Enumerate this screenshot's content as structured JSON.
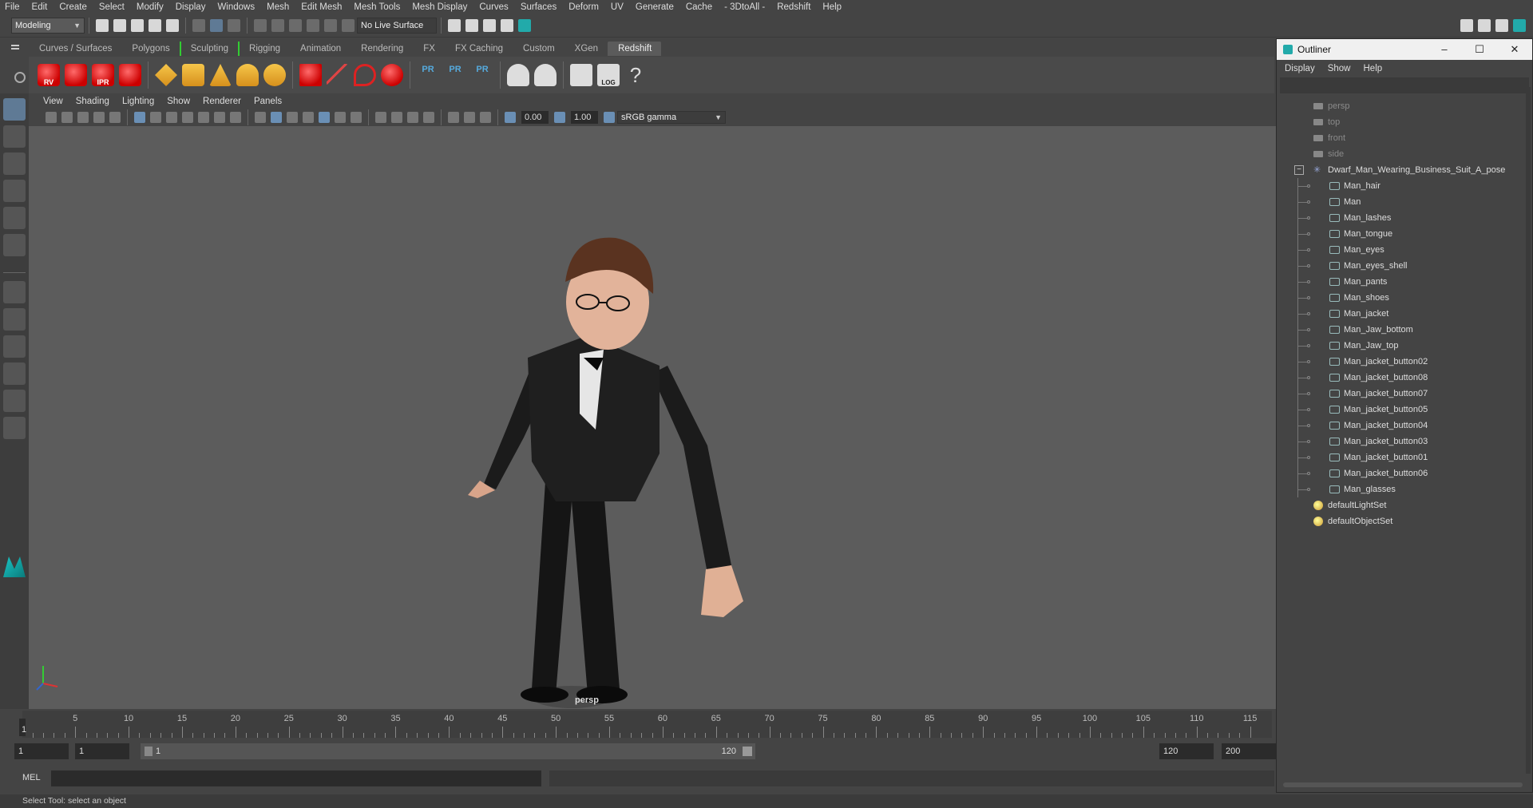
{
  "menubar": [
    "File",
    "Edit",
    "Create",
    "Select",
    "Modify",
    "Display",
    "Windows",
    "Mesh",
    "Edit Mesh",
    "Mesh Tools",
    "Mesh Display",
    "Curves",
    "Surfaces",
    "Deform",
    "UV",
    "Generate",
    "Cache",
    "- 3DtoAll -",
    "Redshift",
    "Help"
  ],
  "status": {
    "mode": "Modeling",
    "live_surface": "No Live Surface"
  },
  "shelf_tabs": [
    "Curves / Surfaces",
    "Polygons",
    "Sculpting",
    "Rigging",
    "Animation",
    "Rendering",
    "FX",
    "FX Caching",
    "Custom",
    "XGen",
    "Redshift"
  ],
  "shelf_icon_labels": [
    "RV",
    "IPR",
    "PR",
    "PR",
    "PR",
    "LOG",
    "?"
  ],
  "panel_menu": [
    "View",
    "Shading",
    "Lighting",
    "Show",
    "Renderer",
    "Panels"
  ],
  "panel_bar": {
    "exposure": "0.00",
    "gamma": "1.00",
    "color_space": "sRGB gamma"
  },
  "viewport": {
    "camera_label": "persp"
  },
  "timeline": {
    "ticks": [
      "5",
      "10",
      "15",
      "20",
      "25",
      "30",
      "35",
      "40",
      "45",
      "50",
      "55",
      "60",
      "65",
      "70",
      "75",
      "80",
      "85",
      "90",
      "95",
      "100",
      "105",
      "110",
      "115"
    ],
    "current": "1"
  },
  "range": {
    "start": "1",
    "current": "1",
    "range_start": "1",
    "range_end": "120",
    "anim_end": "120",
    "max_end": "200"
  },
  "cmdline": {
    "label": "MEL"
  },
  "helpline": "Select Tool: select an object",
  "outliner": {
    "title": "Outliner",
    "menu": [
      "Display",
      "Show",
      "Help"
    ],
    "cameras": [
      "persp",
      "top",
      "front",
      "side"
    ],
    "group": "Dwarf_Man_Wearing_Business_Suit_A_pose",
    "children": [
      "Man_hair",
      "Man",
      "Man_lashes",
      "Man_tongue",
      "Man_eyes",
      "Man_eyes_shell",
      "Man_pants",
      "Man_shoes",
      "Man_jacket",
      "Man_Jaw_bottom",
      "Man_Jaw_top",
      "Man_jacket_button02",
      "Man_jacket_button08",
      "Man_jacket_button07",
      "Man_jacket_button05",
      "Man_jacket_button04",
      "Man_jacket_button03",
      "Man_jacket_button01",
      "Man_jacket_button06",
      "Man_glasses"
    ],
    "sets": [
      "defaultLightSet",
      "defaultObjectSet"
    ]
  }
}
